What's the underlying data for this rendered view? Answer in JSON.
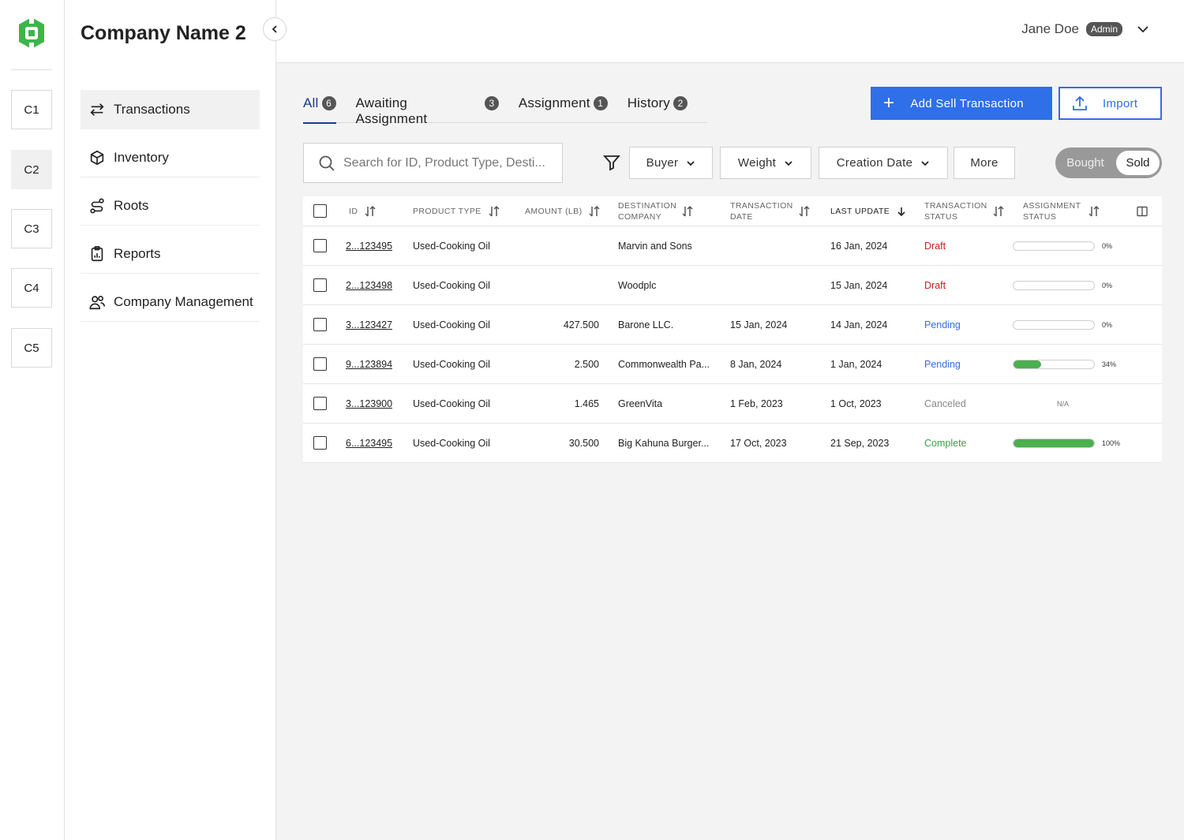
{
  "rail": {
    "companies": [
      "C1",
      "C2",
      "C3",
      "C4",
      "C5"
    ],
    "active_company": "C2"
  },
  "sidebar": {
    "company_name": "Company Name 2",
    "items": [
      {
        "label": "Transactions",
        "icon": "arrows-exchange-icon",
        "active": true
      },
      {
        "label": "Inventory",
        "icon": "box-icon",
        "active": false
      },
      {
        "label": "Roots",
        "icon": "route-icon",
        "active": false
      },
      {
        "label": "Reports",
        "icon": "clipboard-icon",
        "active": false
      },
      {
        "label": "Company Management",
        "icon": "users-icon",
        "active": false
      }
    ]
  },
  "header": {
    "user_name": "Jane Doe",
    "user_role": "Admin"
  },
  "tabs": [
    {
      "label": "All",
      "count": "6",
      "active": true
    },
    {
      "label": "Awaiting Assignment",
      "count": "3",
      "active": false
    },
    {
      "label": "Assignment",
      "count": "1",
      "active": false
    },
    {
      "label": "History",
      "count": "2",
      "active": false
    }
  ],
  "actions": {
    "add_label": "Add Sell Transaction",
    "import_label": "Import"
  },
  "filters": {
    "search_placeholder": "Search for ID, Product Type, Desti...",
    "buyer": "Buyer",
    "weight": "Weight",
    "creation_date": "Creation Date",
    "more": "More",
    "toggle_bought": "Bought",
    "toggle_sold": "Sold",
    "toggle_selected": "Sold"
  },
  "table": {
    "headers": {
      "id": "ID",
      "product_type": "PRODUCT TYPE",
      "amount": "AMOUNT (LB)",
      "destination_company": "DESTINATION COMPANY",
      "transaction_date": "TRANSACTION DATE",
      "last_update": "LAST UPDATE",
      "transaction_status": "TRANSACTION STATUS",
      "assignment_status": "ASSIGNMENT STATUS"
    },
    "rows": [
      {
        "id": "2...123495",
        "product": "Used-Cooking Oil",
        "amount": "",
        "destination": "Marvin and Sons",
        "tx_date": "",
        "last_update": "16 Jan, 2024",
        "status": "Draft",
        "status_class": "st-draft",
        "assignment": "0%",
        "progress": 0
      },
      {
        "id": "2...123498",
        "product": "Used-Cooking Oil",
        "amount": "",
        "destination": "Woodplc",
        "tx_date": "",
        "last_update": "15 Jan, 2024",
        "status": "Draft",
        "status_class": "st-draft",
        "assignment": "0%",
        "progress": 0
      },
      {
        "id": "3...123427",
        "product": "Used-Cooking Oil",
        "amount": "427.500",
        "destination": "Barone LLC.",
        "tx_date": "15 Jan, 2024",
        "last_update": "14 Jan, 2024",
        "status": "Pending",
        "status_class": "st-pending",
        "assignment": "0%",
        "progress": 0
      },
      {
        "id": "9...123894",
        "product": "Used-Cooking Oil",
        "amount": "2.500",
        "destination": "Commonwealth Pa...",
        "tx_date": "8 Jan, 2024",
        "last_update": "1 Jan, 2024",
        "status": "Pending",
        "status_class": "st-pending",
        "assignment": "34%",
        "progress": 0.34
      },
      {
        "id": "3...123900",
        "product": "Used-Cooking Oil",
        "amount": "1.465",
        "destination": "GreenVita",
        "tx_date": "1 Feb, 2023",
        "last_update": "1 Oct, 2023",
        "status": "Canceled",
        "status_class": "st-canceled",
        "assignment": "N/A",
        "progress": null
      },
      {
        "id": "6...123495",
        "product": "Used-Cooking Oil",
        "amount": "30.500",
        "destination": "Big Kahuna Burger...",
        "tx_date": "17 Oct, 2023",
        "last_update": "21 Sep, 2023",
        "status": "Complete",
        "status_class": "st-complete",
        "assignment": "100%",
        "progress": 1
      }
    ]
  },
  "colors": {
    "accent": "#2f6fe8",
    "tab_active": "#1a3a8a",
    "logo": "#3db54a",
    "draft": "#d01c1c",
    "pending": "#2f6fe8",
    "complete": "#34a34a",
    "canceled": "#888888"
  }
}
